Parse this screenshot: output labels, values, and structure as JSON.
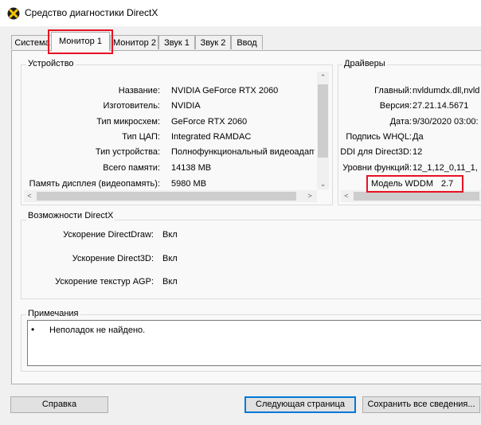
{
  "window": {
    "title": "Средство диагностики DirectX"
  },
  "tabs": [
    {
      "label": "Система"
    },
    {
      "label": "Монитор 1"
    },
    {
      "label": "Монитор 2"
    },
    {
      "label": "Звук 1"
    },
    {
      "label": "Звук 2"
    },
    {
      "label": "Ввод"
    }
  ],
  "device": {
    "title": "Устройство",
    "rows": [
      {
        "label": "Название:",
        "value": "NVIDIA GeForce RTX 2060"
      },
      {
        "label": "Изготовитель:",
        "value": "NVIDIA"
      },
      {
        "label": "Тип микросхем:",
        "value": "GeForce RTX 2060"
      },
      {
        "label": "Тип ЦАП:",
        "value": "Integrated RAMDAC"
      },
      {
        "label": "Тип устройства:",
        "value": "Полнофункциональный видеоадапт"
      },
      {
        "label": "Всего памяти:",
        "value": "14138 MB"
      },
      {
        "label": "Память дисплея (видеопамять):",
        "value": "5980 MB"
      }
    ]
  },
  "drivers": {
    "title": "Драйверы",
    "rows": [
      {
        "label": "Главный:",
        "value": "nvldumdx.dll,nvld"
      },
      {
        "label": "Версия:",
        "value": "27.21.14.5671"
      },
      {
        "label": "Дата:",
        "value": "9/30/2020 03:00:"
      },
      {
        "label": "Подпись WHQL:",
        "value": "Да"
      },
      {
        "label": "DDI для Direct3D:",
        "value": "12"
      },
      {
        "label": "Уровни функций:",
        "value": "12_1,12_0,11_1,"
      },
      {
        "label": "Модель WDDM",
        "value": "2.7"
      }
    ]
  },
  "features": {
    "title": "Возможности DirectX",
    "rows": [
      {
        "label": "Ускорение DirectDraw:",
        "value": "Вкл"
      },
      {
        "label": "Ускорение Direct3D:",
        "value": "Вкл"
      },
      {
        "label": "Ускорение текстур AGP:",
        "value": "Вкл"
      }
    ]
  },
  "notes": {
    "title": "Примечания",
    "items": [
      "Неполадок не найдено."
    ]
  },
  "buttons": {
    "help": "Справка",
    "next": "Следующая страница",
    "save": "Сохранить все сведения..."
  },
  "colors": {
    "highlight": "#e81123",
    "accent": "#0078d7"
  }
}
